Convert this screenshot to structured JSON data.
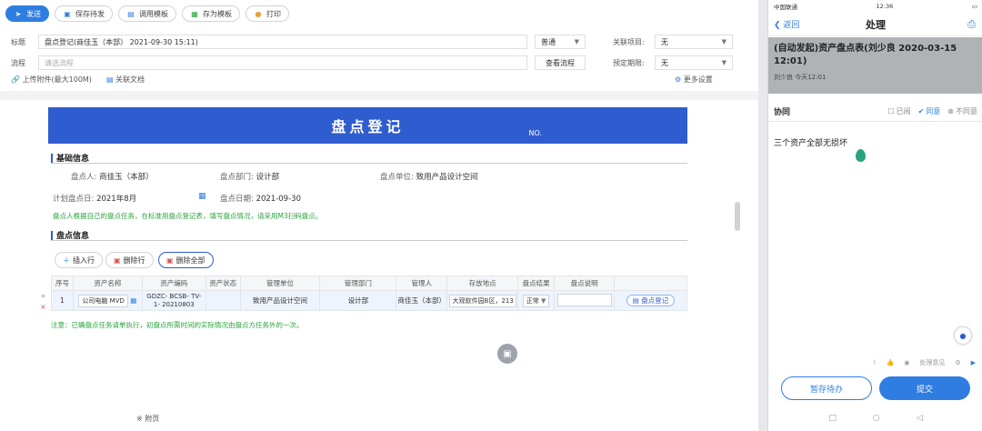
{
  "toolbar": {
    "send": "发送",
    "save_draft": "保存待发",
    "call_template": "调用模板",
    "save_as_template": "存为模板",
    "print": "打印"
  },
  "form_meta": {
    "title_label": "标题",
    "title_value": "盘点登记(商佳玉（本部） 2021-09-30 15:11)",
    "flow_label": "流程",
    "flow_placeholder": "请选流程",
    "type_value": "普通",
    "view_flow": "查看流程",
    "related_project_label": "关联项目:",
    "related_project_value": "无",
    "deadline_label": "预定期限:",
    "deadline_value": "无",
    "upload_attach": "上传附件(最大100M)",
    "related_doc": "关联文档",
    "more_settings": "更多设置"
  },
  "form": {
    "title": "盘点登记",
    "number": "NO.",
    "basic_info": "基础信息",
    "inventory_person_label": "盘点人:",
    "inventory_person": "商佳玉（本部）",
    "inventory_dept_label": "盘点部门:",
    "inventory_dept": "设计部",
    "inventory_unit_label": "盘点单位:",
    "inventory_unit": "致用产品设计空间",
    "plan_time_label": "计划盘点日:",
    "plan_time": "2021年8月",
    "actual_time_label": "盘点日期:",
    "actual_time": "2021-09-30",
    "hint": "盘点人根据自己的盘点任务，在标准用盘点登记表，填写盘点情况，请采用M3扫码盘点。",
    "inventory_info": "盘点信息",
    "insert_row": "插入行",
    "delete_row": "删除行",
    "delete_all": "删除全部",
    "table": {
      "headers": [
        "序号",
        "资产名称",
        "资产编码",
        "资产状态",
        "管理单位",
        "管理部门",
        "管理人",
        "存放地点",
        "盘点结果",
        "盘点说明",
        ""
      ],
      "row": [
        "1",
        "公司电脑 MVD",
        "GDZC- BCSB- TV- 1- 20210803",
        "",
        "致用产品设计空间",
        "设计部",
        "商佳玉（本部）",
        "大观软件园B区，213",
        "正常",
        "",
        "盘点登记"
      ]
    },
    "note": "注意：已确盘点任务请单执行，初盘点所需时间的实际情况由盘点方任务外的一次。"
  },
  "bottom_link": "※ 附页",
  "mobile": {
    "carrier": "中国联通",
    "time": "12:36",
    "back": "返回",
    "nav_title": "处理",
    "doc_title": "(自动发起)资产盘点表(刘少良 2020-03-15 12:01)",
    "doc_meta": "刘少良  今天12:01",
    "opinion_label": "协同",
    "tab_read": "已阅",
    "tab_agree": "同意",
    "tab_disagree": "不同意",
    "comment": "三个资产全部无损坏",
    "tool_label": "处理意见",
    "btn_hold": "暂存待办",
    "btn_submit": "提交"
  },
  "colors": {
    "accent": "#2f7de1",
    "header_blue": "#2f5dcf",
    "hint_green": "#2aa33b"
  }
}
